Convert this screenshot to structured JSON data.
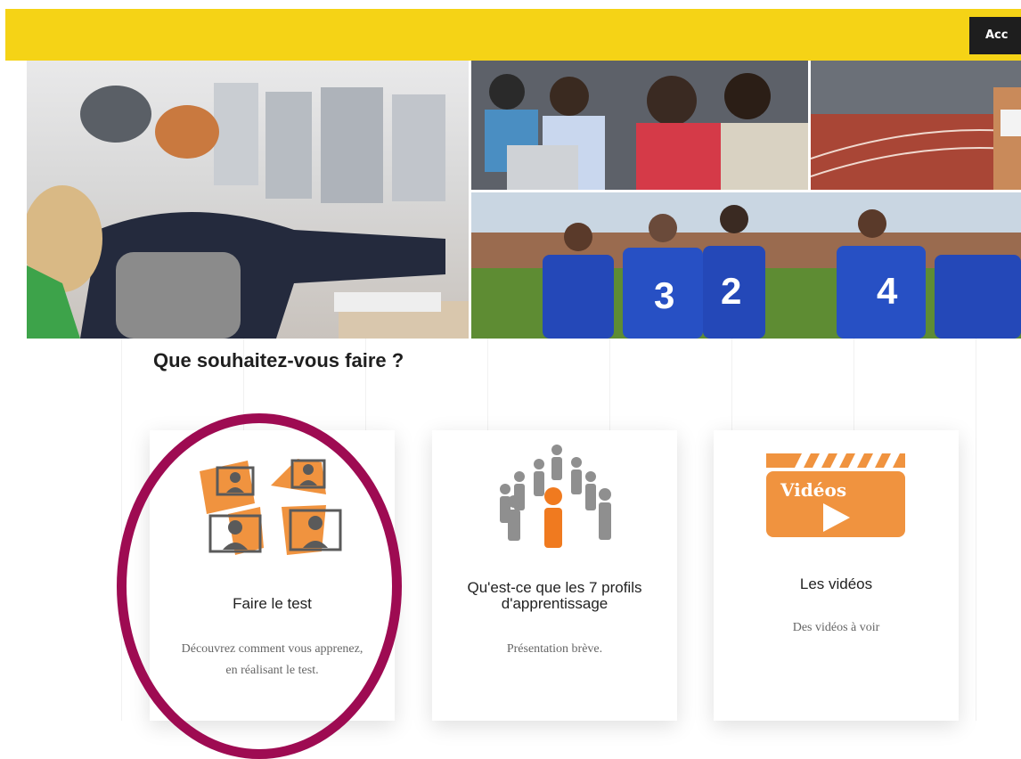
{
  "header": {
    "account_button_label": "Acc",
    "accent_color": "#f5d316"
  },
  "main": {
    "title": "Que souhaitez-vous faire ?"
  },
  "cards": [
    {
      "title": "Faire le test",
      "description_lines": [
        "Découvrez comment vous apprenez,",
        "en réalisant le test."
      ],
      "icon": "computer-group-icon"
    },
    {
      "title_lines": [
        "Qu'est-ce que les 7 profils",
        "d'apprentissage"
      ],
      "description": "Présentation brève.",
      "icon": "people-group-icon"
    },
    {
      "title": "Les vidéos",
      "description": "Des vidéos à voir",
      "icon": "video-clapperboard-icon",
      "icon_label": "Vidéos"
    }
  ],
  "highlight": {
    "color": "#9e0b52"
  }
}
